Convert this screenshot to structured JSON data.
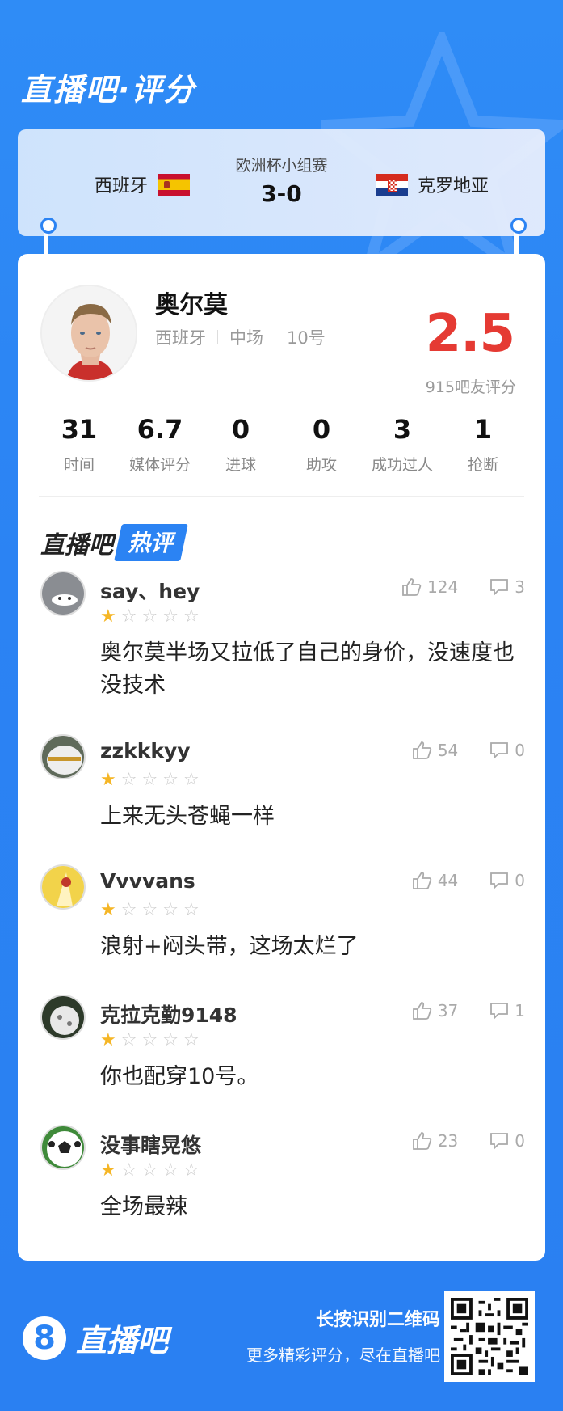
{
  "header": {
    "title": "直播吧·评分"
  },
  "match": {
    "home_team": "西班牙",
    "away_team": "克罗地亚",
    "competition": "欧洲杯小组赛",
    "score": "3-0",
    "home_flag_icon": "spain-flag-icon",
    "away_flag_icon": "croatia-flag-icon"
  },
  "player": {
    "name": "奥尔莫",
    "team": "西班牙",
    "position": "中场",
    "number": "10号",
    "rating": "2.5",
    "rating_count": "915吧友评分",
    "rating_color": "#e53a33"
  },
  "stats": [
    {
      "value": "31",
      "label": "时间"
    },
    {
      "value": "6.7",
      "label": "媒体评分"
    },
    {
      "value": "0",
      "label": "进球"
    },
    {
      "value": "0",
      "label": "助攻"
    },
    {
      "value": "3",
      "label": "成功过人"
    },
    {
      "value": "1",
      "label": "抢断"
    }
  ],
  "hot_section": {
    "title_part1": "直播吧",
    "title_part2": "热评"
  },
  "comments": [
    {
      "user": "say、hey",
      "stars": 1,
      "likes": "124",
      "replies": "3",
      "text": "奥尔莫半场又拉低了自己的身价，没速度也没技术"
    },
    {
      "user": "zzkkkyy",
      "stars": 1,
      "likes": "54",
      "replies": "0",
      "text": "上来无头苍蝇一样"
    },
    {
      "user": "Vvvvans",
      "stars": 1,
      "likes": "44",
      "replies": "0",
      "text": "浪射+闷头带，这场太烂了"
    },
    {
      "user": "克拉克勤9148",
      "stars": 1,
      "likes": "37",
      "replies": "1",
      "text": "你也配穿10号。"
    },
    {
      "user": "没事瞎晃悠",
      "stars": 1,
      "likes": "23",
      "replies": "0",
      "text": "全场最辣"
    }
  ],
  "footer": {
    "logo_number": "8",
    "logo_text": "直播吧",
    "line1": "长按识别二维码",
    "line2": "更多精彩评分，尽在直播吧"
  },
  "colors": {
    "primary": "#2b83f3",
    "star_on": "#f5b626",
    "star_off": "#c9c9c9"
  }
}
